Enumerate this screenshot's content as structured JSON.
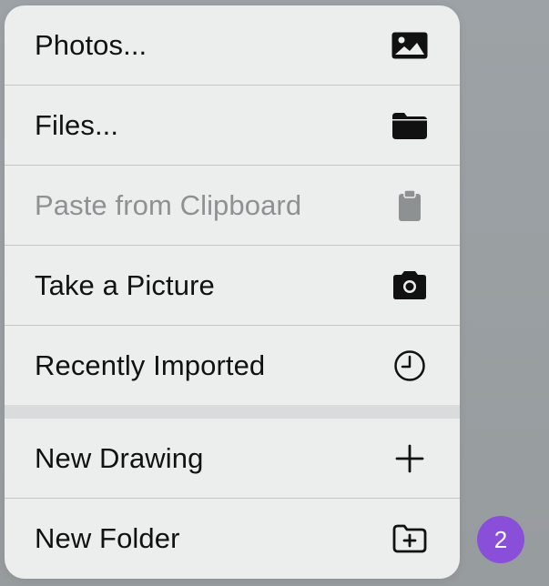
{
  "menu": {
    "items": [
      {
        "label": "Photos...",
        "icon": "photo-icon",
        "enabled": true
      },
      {
        "label": "Files...",
        "icon": "folder-icon",
        "enabled": true
      },
      {
        "label": "Paste from Clipboard",
        "icon": "clipboard-icon",
        "enabled": false
      },
      {
        "label": "Take a Picture",
        "icon": "camera-icon",
        "enabled": true
      },
      {
        "label": "Recently Imported",
        "icon": "clock-icon",
        "enabled": true
      },
      {
        "label": "New Drawing",
        "icon": "plus-icon",
        "enabled": true
      },
      {
        "label": "New Folder",
        "icon": "folder-plus-icon",
        "enabled": true
      }
    ]
  },
  "badge": {
    "count": "2",
    "color": "#8a4fd8"
  },
  "colors": {
    "text": "#111111",
    "disabled_text": "#8e9192",
    "menu_bg": "#eceeee",
    "backdrop": "#9aa0a3"
  }
}
